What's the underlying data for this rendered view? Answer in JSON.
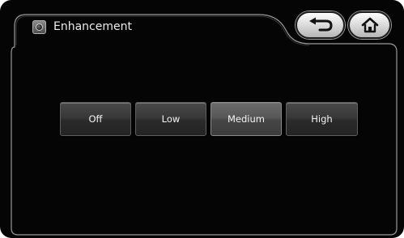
{
  "window": {
    "title": "Enhancement",
    "title_icon": "enhancement-icon"
  },
  "nav": {
    "back_icon": "back-arrow-icon",
    "home_icon": "home-icon"
  },
  "enhancement_options": {
    "items": [
      {
        "label": "Off",
        "selected": false
      },
      {
        "label": "Low",
        "selected": false
      },
      {
        "label": "Medium",
        "selected": true
      },
      {
        "label": "High",
        "selected": false
      }
    ]
  },
  "colors": {
    "background": "#050505",
    "panel_border": "#8a8a8a",
    "button_face": "#383838",
    "button_selected": "#575757",
    "text": "#f4f4f4"
  }
}
